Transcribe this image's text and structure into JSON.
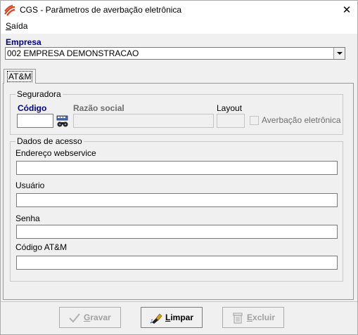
{
  "window": {
    "title": "CGS - Parâmetros de averbação eletrônica",
    "close_glyph": "✕"
  },
  "menu": {
    "items": [
      {
        "accel": "S",
        "rest": "aída"
      }
    ]
  },
  "empresa": {
    "label": "Empresa",
    "selected": "002 EMPRESA DEMONSTRACAO"
  },
  "tabs": [
    {
      "label": "AT&M"
    }
  ],
  "seguradora": {
    "group_title": "Seguradora",
    "codigo_label": "Código",
    "codigo_value": "",
    "razao_label": "Razão social",
    "razao_value": "",
    "layout_label": "Layout",
    "layout_value": "",
    "averbacao_label": "Averbação eletrônica",
    "averbacao_checked": false
  },
  "dados_acesso": {
    "group_title": "Dados de acesso",
    "endereco_label": "Endereço webservice",
    "endereco_value": "",
    "usuario_label": "Usuário",
    "usuario_value": "",
    "senha_label": "Senha",
    "senha_value": "",
    "codigo_atm_label": "Código AT&M",
    "codigo_atm_value": ""
  },
  "buttons": {
    "gravar": {
      "accel": "G",
      "rest": "ravar",
      "enabled": false
    },
    "limpar": {
      "accel": "L",
      "rest": "impar",
      "enabled": true
    },
    "excluir": {
      "accel": "E",
      "rest": "xcluir",
      "enabled": false
    }
  },
  "colors": {
    "label_accent": "#000080",
    "disabled_text": "#a0a0a0"
  }
}
